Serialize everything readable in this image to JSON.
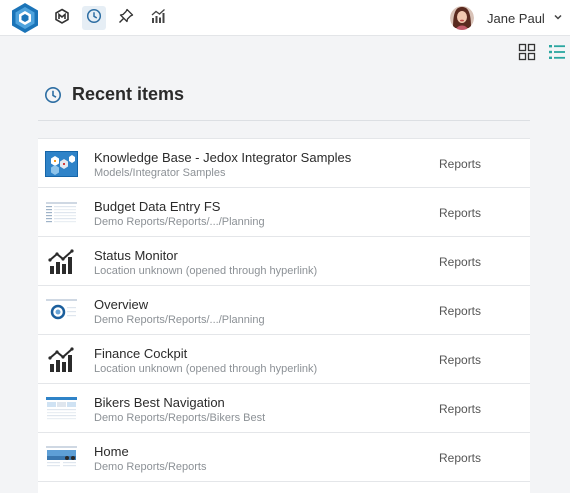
{
  "user": {
    "name": "Jane Paul"
  },
  "page": {
    "title": "Recent items"
  },
  "items": [
    {
      "name": "Knowledge Base - Jedox Integrator Samples",
      "path": "Models/Integrator Samples",
      "type": "Reports",
      "icon": "model-thumbnail"
    },
    {
      "name": "Budget Data Entry FS",
      "path": "Demo Reports/Reports/.../Planning",
      "type": "Reports",
      "icon": "spreadsheet-thumbnail"
    },
    {
      "name": "Status Monitor",
      "path": "Location unknown (opened through hyperlink)",
      "type": "Reports",
      "icon": "report-chart-icon"
    },
    {
      "name": "Overview",
      "path": "Demo Reports/Reports/.../Planning",
      "type": "Reports",
      "icon": "overview-thumbnail"
    },
    {
      "name": "Finance Cockpit",
      "path": "Location unknown (opened through hyperlink)",
      "type": "Reports",
      "icon": "report-chart-icon"
    },
    {
      "name": "Bikers Best Navigation",
      "path": "Demo Reports/Reports/Bikers Best",
      "type": "Reports",
      "icon": "navigation-thumbnail"
    },
    {
      "name": "Home",
      "path": "Demo Reports/Reports",
      "type": "Reports",
      "icon": "home-thumbnail"
    }
  ]
}
